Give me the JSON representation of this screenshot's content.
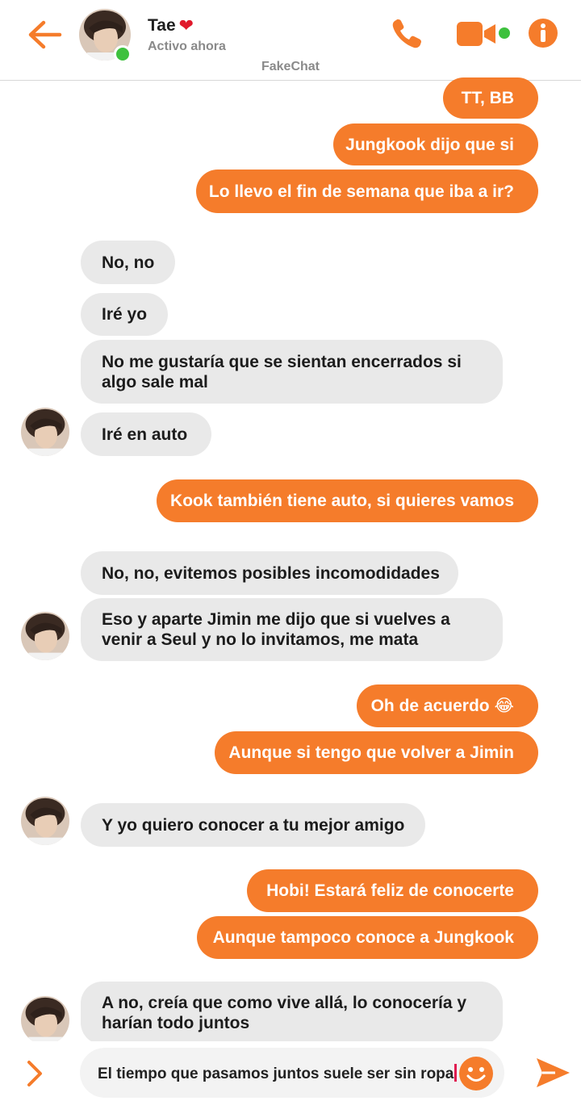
{
  "header": {
    "contact_name": "Tae",
    "heart_glyph": "❤",
    "status": "Activo ahora",
    "app_name": "FakeChat",
    "accent_color": "#f57c2b",
    "online_color": "#3ec13e"
  },
  "messages": [
    {
      "from": "me",
      "text": "TT, BB"
    },
    {
      "from": "me",
      "text": "Jungkook dijo que si"
    },
    {
      "from": "me",
      "text": "Lo llevo el fin de semana que iba a ir?"
    },
    {
      "from": "them",
      "text": "No, no"
    },
    {
      "from": "them",
      "text": "Iré yo"
    },
    {
      "from": "them",
      "text": "No me gustaría que se sientan encerrados si algo sale mal"
    },
    {
      "from": "them",
      "text": "Iré en auto"
    },
    {
      "from": "me",
      "text": "Kook también tiene auto, si quieres vamos"
    },
    {
      "from": "them",
      "text": "No, no, evitemos posibles incomodidades"
    },
    {
      "from": "them",
      "text": "Eso y aparte Jimin me dijo que si vuelves a venir a Seul y no lo invitamos, me mata"
    },
    {
      "from": "me",
      "text": "Oh de acuerdo 😂"
    },
    {
      "from": "me",
      "text": "Aunque si tengo que volver a Jimin"
    },
    {
      "from": "them",
      "text": "Y yo quiero conocer a tu mejor amigo"
    },
    {
      "from": "me",
      "text": "Hobi! Estará feliz de conocerte"
    },
    {
      "from": "me",
      "text": "Aunque tampoco conoce a Jungkook"
    },
    {
      "from": "them",
      "text": "A no, creía que como vive allá, lo conocería y harían todo juntos"
    }
  ],
  "composer": {
    "input_value": "El tiempo que pasamos juntos suele ser sin ropa"
  },
  "icons": [
    "back-arrow-icon",
    "phone-icon",
    "video-camera-icon",
    "info-icon",
    "chevron-right-icon",
    "emoji-icon",
    "send-icon"
  ]
}
